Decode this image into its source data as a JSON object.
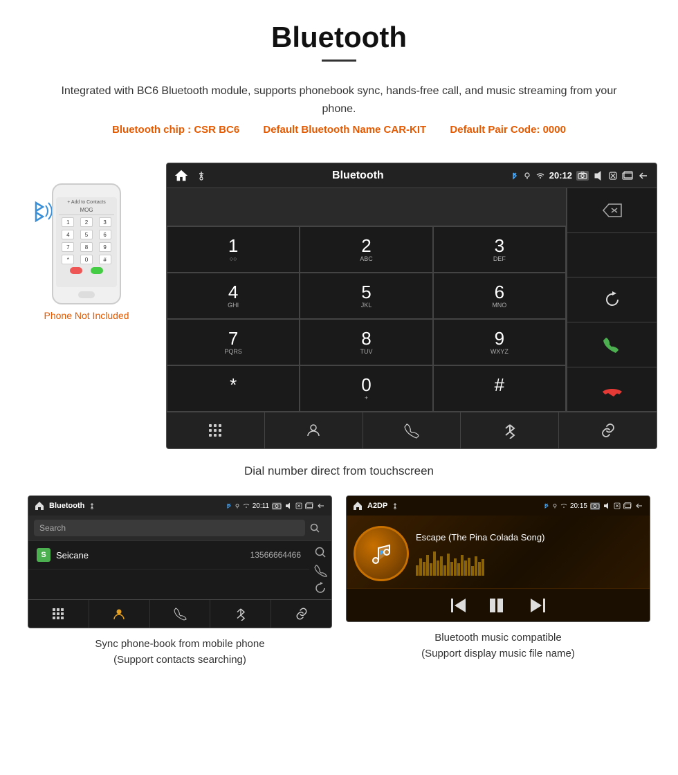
{
  "page": {
    "title": "Bluetooth",
    "description": "Integrated with BC6 Bluetooth module, supports phonebook sync, hands-free call, and music streaming from your phone.",
    "specs": {
      "chip": "Bluetooth chip : CSR BC6",
      "name": "Default Bluetooth Name CAR-KIT",
      "code": "Default Pair Code: 0000"
    },
    "phone_not_included": "Phone Not Included"
  },
  "main_screen": {
    "status_bar": {
      "app_name": "Bluetooth",
      "time": "20:12"
    },
    "dialpad": {
      "keys": [
        {
          "num": "1",
          "letters": "○○"
        },
        {
          "num": "2",
          "letters": "ABC"
        },
        {
          "num": "3",
          "letters": "DEF"
        },
        {
          "num": "4",
          "letters": "GHI"
        },
        {
          "num": "5",
          "letters": "JKL"
        },
        {
          "num": "6",
          "letters": "MNO"
        },
        {
          "num": "7",
          "letters": "PQRS"
        },
        {
          "num": "8",
          "letters": "TUV"
        },
        {
          "num": "9",
          "letters": "WXYZ"
        },
        {
          "num": "*",
          "letters": ""
        },
        {
          "num": "0",
          "letters": "+"
        },
        {
          "num": "#",
          "letters": ""
        }
      ]
    }
  },
  "main_caption": "Dial number direct from touchscreen",
  "phonebook_screen": {
    "status_bar": {
      "app_name": "Bluetooth",
      "time": "20:11"
    },
    "search_placeholder": "Search",
    "contact": {
      "letter": "S",
      "name": "Seicane",
      "number": "13566664466"
    },
    "caption_line1": "Sync phone-book from mobile phone",
    "caption_line2": "(Support contacts searching)"
  },
  "music_screen": {
    "status_bar": {
      "app_name": "A2DP",
      "time": "20:15"
    },
    "song_title": "Escape (The Pina Colada Song)",
    "caption_line1": "Bluetooth music compatible",
    "caption_line2": "(Support display music file name)"
  }
}
